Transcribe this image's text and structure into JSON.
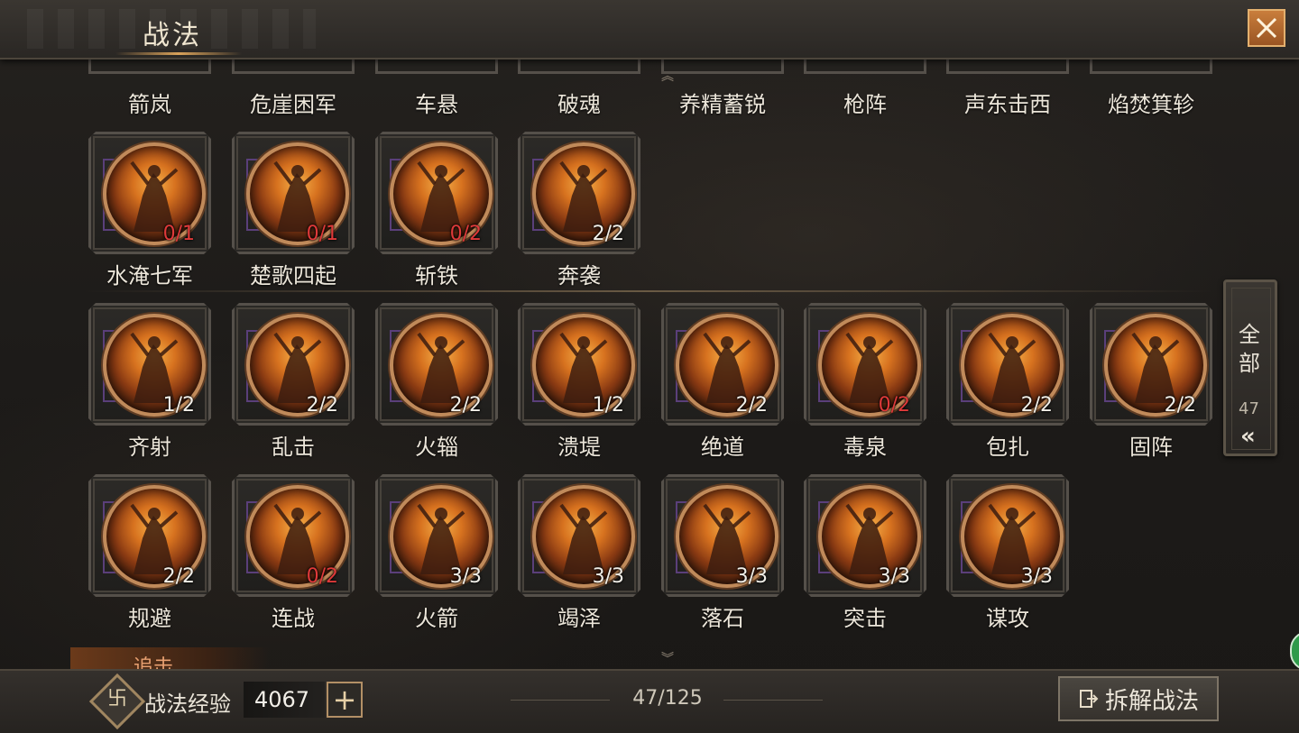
{
  "header": {
    "title": "战法"
  },
  "top_row_labels": [
    "箭岚",
    "危崖困军",
    "车悬",
    "破魂",
    "养精蓄锐",
    "枪阵",
    "声东击西",
    "焰焚箕轸"
  ],
  "rows": [
    [
      {
        "name": "水淹七军",
        "count": "0/1",
        "red": true
      },
      {
        "name": "楚歌四起",
        "count": "0/1",
        "red": true
      },
      {
        "name": "斩铁",
        "count": "0/2",
        "red": true
      },
      {
        "name": "奔袭",
        "count": "2/2",
        "red": false
      }
    ],
    [
      {
        "name": "齐射",
        "count": "1/2",
        "red": false
      },
      {
        "name": "乱击",
        "count": "2/2",
        "red": false
      },
      {
        "name": "火辎",
        "count": "2/2",
        "red": false
      },
      {
        "name": "溃堤",
        "count": "1/2",
        "red": false
      },
      {
        "name": "绝道",
        "count": "2/2",
        "red": false
      },
      {
        "name": "毒泉",
        "count": "0/2",
        "red": true
      },
      {
        "name": "包扎",
        "count": "2/2",
        "red": false
      },
      {
        "name": "固阵",
        "count": "2/2",
        "red": false
      }
    ],
    [
      {
        "name": "规避",
        "count": "2/2",
        "red": false
      },
      {
        "name": "连战",
        "count": "0/2",
        "red": true
      },
      {
        "name": "火箭",
        "count": "3/3",
        "red": false
      },
      {
        "name": "竭泽",
        "count": "3/3",
        "red": false
      },
      {
        "name": "落石",
        "count": "3/3",
        "red": false
      },
      {
        "name": "突击",
        "count": "3/3",
        "red": false
      },
      {
        "name": "谋攻",
        "count": "3/3",
        "red": false
      }
    ]
  ],
  "next_section_partial": "追击",
  "side_tab": {
    "line1": "全",
    "line2": "部",
    "count": "47",
    "arrows": "«"
  },
  "footer": {
    "exp_label": "战法经验",
    "exp_value": "4067",
    "plus": "+",
    "page_count": "47/125",
    "disassemble_label": "拆解战法"
  },
  "colors": {
    "accent": "#c97e3c",
    "red_count": "#e03a3a"
  },
  "icons": {
    "close": "close-icon",
    "exp": "tactic-exp-icon",
    "disassemble": "disassemble-icon"
  }
}
